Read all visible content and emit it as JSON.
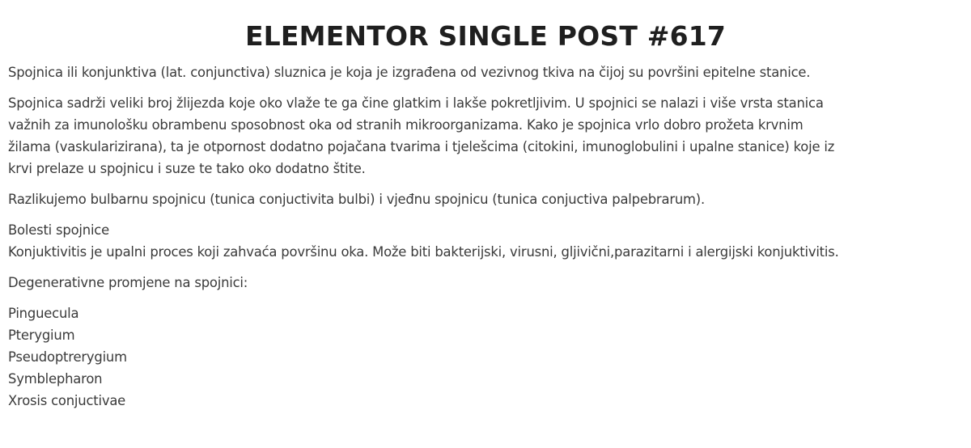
{
  "post": {
    "title": "ELEMENTOR SINGLE POST #617",
    "paragraph_1": "Spojnica ili konjunktiva (lat. conjunctiva) sluznica je koja je izgrađena od vezivnog tkiva na čijoj su površini epitelne stanice.",
    "paragraph_2_lines": [
      "Spojnica sadrži veliki broj žlijezda koje oko vlaže te ga čine glatkim i lakše pokretljivim. U spojnici se nalazi i više vrsta stanica",
      "važnih za imunološku obrambenu sposobnost oka od stranih mikroorganizama. Kako je spojnica vrlo dobro prožeta krvnim",
      "žilama (vaskularizirana), ta je otpornost dodatno pojačana tvarima i tjelešcima (citokini, imunoglobulini i upalne stanice) koje iz",
      "krvi prelaze u spojnicu i suze te tako oko dodatno štite."
    ],
    "paragraph_3": "Razlikujemo bulbarnu spojnicu (tunica conjuctivita bulbi) i vjeđnu spojnicu (tunica conjuctiva palpebrarum).",
    "section_heading": "Bolesti spojnice",
    "paragraph_4": "Konjuktivitis je upalni proces koji zahvaća površinu oka. Može biti bakterijski, virusni, gljivični,parazitarni i alergijski konjuktivitis.",
    "paragraph_5": "Degenerativne promjene na spojnici:",
    "degenerative_list": [
      "Pinguecula",
      "Pterygium",
      "Pseudoptrerygium",
      "Symblepharon",
      "Xrosis conjuctivae"
    ]
  }
}
